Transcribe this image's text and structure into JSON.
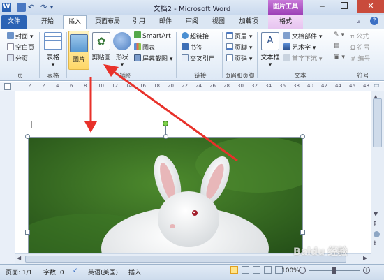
{
  "title": "文档2 - Microsoft Word",
  "contextual": {
    "label": "图片工具",
    "tab": "格式"
  },
  "tabs": {
    "file": "文件",
    "home": "开始",
    "insert": "插入",
    "layout": "页面布局",
    "references": "引用",
    "mailings": "邮件",
    "review": "审阅",
    "view": "视图",
    "addins": "加载项"
  },
  "ribbon": {
    "pages": {
      "cover": "封面",
      "blank": "空白页",
      "break": "分页",
      "group": "页"
    },
    "tables": {
      "table": "表格",
      "group": "表格"
    },
    "illustrations": {
      "picture": "图片",
      "clipart": "剪贴画",
      "shapes": "形状",
      "smartart": "SmartArt",
      "chart": "图表",
      "screenshot": "屏幕截图",
      "group": "插图"
    },
    "links": {
      "hyperlink": "超链接",
      "bookmark": "书签",
      "crossref": "交叉引用",
      "group": "链接"
    },
    "headerfooter": {
      "header": "页眉",
      "footer": "页脚",
      "pagenum": "页码",
      "group": "页眉和页脚"
    },
    "text": {
      "textbox": "文本框",
      "parts": "文档部件",
      "wordart": "艺术字",
      "dropcap": "首字下沉",
      "group": "文本"
    },
    "symbols": {
      "equation": "公式",
      "symbol": "符号",
      "number": "编号",
      "group": "符号"
    }
  },
  "ruler_numbers": [
    "2",
    "2",
    "4",
    "6",
    "8",
    "10",
    "12",
    "14",
    "16",
    "18",
    "20",
    "22",
    "24",
    "26",
    "28",
    "30",
    "32",
    "34",
    "36",
    "38",
    "40",
    "42",
    "44",
    "46",
    "48"
  ],
  "status": {
    "page": "页面: 1/1",
    "words": "字数: 0",
    "language": "英语(美国)",
    "mode": "插入",
    "zoom": "100%"
  },
  "watermark": "Baidu 经验",
  "colors": {
    "accent": "#2b63b5",
    "context": "#a64bbd",
    "arrow": "#e8312a"
  }
}
